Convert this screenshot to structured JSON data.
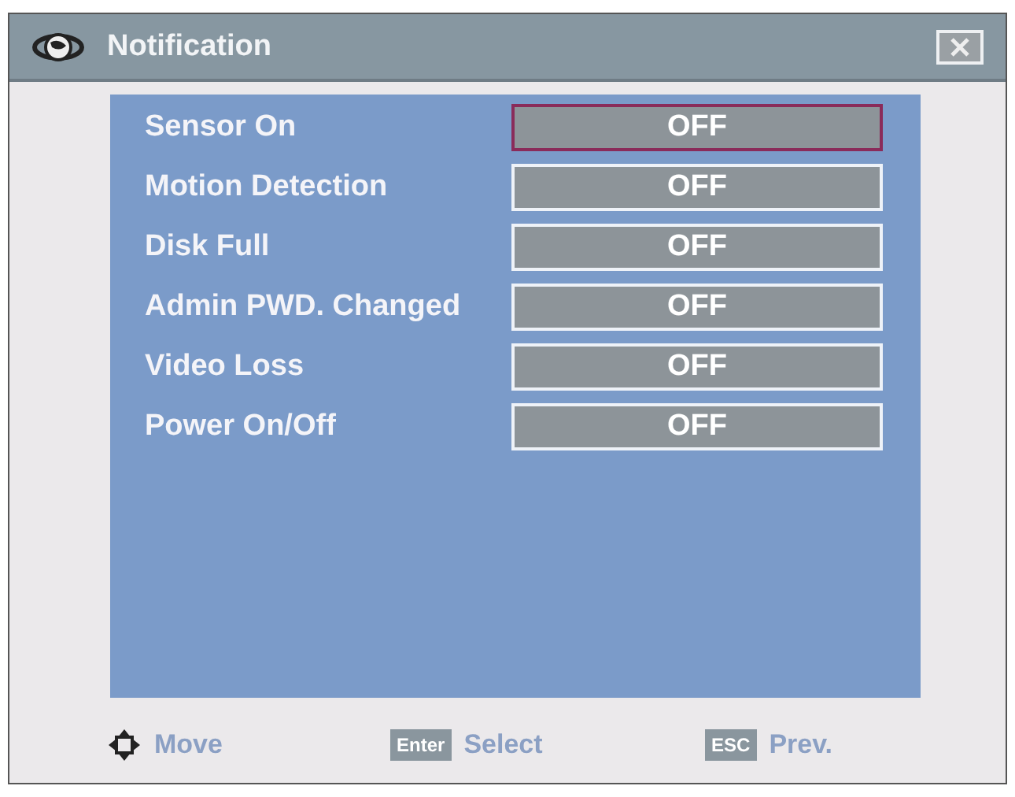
{
  "window": {
    "title": "Notification"
  },
  "rows": [
    {
      "label": "Sensor On",
      "value": "OFF",
      "selected": true
    },
    {
      "label": "Motion Detection",
      "value": "OFF",
      "selected": false
    },
    {
      "label": "Disk Full",
      "value": "OFF",
      "selected": false
    },
    {
      "label": "Admin PWD. Changed",
      "value": "OFF",
      "selected": false
    },
    {
      "label": "Video Loss",
      "value": "OFF",
      "selected": false
    },
    {
      "label": "Power On/Off",
      "value": "OFF",
      "selected": false
    }
  ],
  "footer": [
    {
      "kind": "dpad",
      "label": "Move"
    },
    {
      "kind": "key",
      "key": "Enter",
      "label": "Select"
    },
    {
      "kind": "key",
      "key": "ESC",
      "label": "Prev."
    }
  ]
}
